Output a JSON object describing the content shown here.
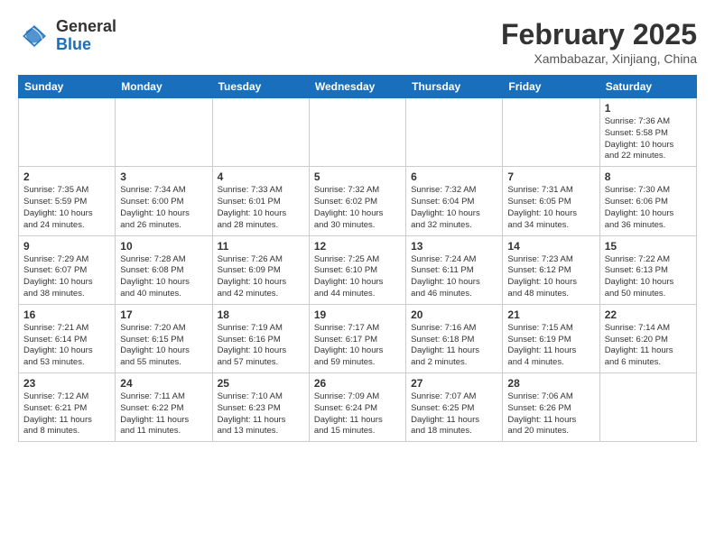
{
  "header": {
    "logo_general": "General",
    "logo_blue": "Blue",
    "month": "February 2025",
    "location": "Xambabazar, Xinjiang, China"
  },
  "days_of_week": [
    "Sunday",
    "Monday",
    "Tuesday",
    "Wednesday",
    "Thursday",
    "Friday",
    "Saturday"
  ],
  "weeks": [
    [
      {
        "day": "",
        "info": ""
      },
      {
        "day": "",
        "info": ""
      },
      {
        "day": "",
        "info": ""
      },
      {
        "day": "",
        "info": ""
      },
      {
        "day": "",
        "info": ""
      },
      {
        "day": "",
        "info": ""
      },
      {
        "day": "1",
        "info": "Sunrise: 7:36 AM\nSunset: 5:58 PM\nDaylight: 10 hours\nand 22 minutes."
      }
    ],
    [
      {
        "day": "2",
        "info": "Sunrise: 7:35 AM\nSunset: 5:59 PM\nDaylight: 10 hours\nand 24 minutes."
      },
      {
        "day": "3",
        "info": "Sunrise: 7:34 AM\nSunset: 6:00 PM\nDaylight: 10 hours\nand 26 minutes."
      },
      {
        "day": "4",
        "info": "Sunrise: 7:33 AM\nSunset: 6:01 PM\nDaylight: 10 hours\nand 28 minutes."
      },
      {
        "day": "5",
        "info": "Sunrise: 7:32 AM\nSunset: 6:02 PM\nDaylight: 10 hours\nand 30 minutes."
      },
      {
        "day": "6",
        "info": "Sunrise: 7:32 AM\nSunset: 6:04 PM\nDaylight: 10 hours\nand 32 minutes."
      },
      {
        "day": "7",
        "info": "Sunrise: 7:31 AM\nSunset: 6:05 PM\nDaylight: 10 hours\nand 34 minutes."
      },
      {
        "day": "8",
        "info": "Sunrise: 7:30 AM\nSunset: 6:06 PM\nDaylight: 10 hours\nand 36 minutes."
      }
    ],
    [
      {
        "day": "9",
        "info": "Sunrise: 7:29 AM\nSunset: 6:07 PM\nDaylight: 10 hours\nand 38 minutes."
      },
      {
        "day": "10",
        "info": "Sunrise: 7:28 AM\nSunset: 6:08 PM\nDaylight: 10 hours\nand 40 minutes."
      },
      {
        "day": "11",
        "info": "Sunrise: 7:26 AM\nSunset: 6:09 PM\nDaylight: 10 hours\nand 42 minutes."
      },
      {
        "day": "12",
        "info": "Sunrise: 7:25 AM\nSunset: 6:10 PM\nDaylight: 10 hours\nand 44 minutes."
      },
      {
        "day": "13",
        "info": "Sunrise: 7:24 AM\nSunset: 6:11 PM\nDaylight: 10 hours\nand 46 minutes."
      },
      {
        "day": "14",
        "info": "Sunrise: 7:23 AM\nSunset: 6:12 PM\nDaylight: 10 hours\nand 48 minutes."
      },
      {
        "day": "15",
        "info": "Sunrise: 7:22 AM\nSunset: 6:13 PM\nDaylight: 10 hours\nand 50 minutes."
      }
    ],
    [
      {
        "day": "16",
        "info": "Sunrise: 7:21 AM\nSunset: 6:14 PM\nDaylight: 10 hours\nand 53 minutes."
      },
      {
        "day": "17",
        "info": "Sunrise: 7:20 AM\nSunset: 6:15 PM\nDaylight: 10 hours\nand 55 minutes."
      },
      {
        "day": "18",
        "info": "Sunrise: 7:19 AM\nSunset: 6:16 PM\nDaylight: 10 hours\nand 57 minutes."
      },
      {
        "day": "19",
        "info": "Sunrise: 7:17 AM\nSunset: 6:17 PM\nDaylight: 10 hours\nand 59 minutes."
      },
      {
        "day": "20",
        "info": "Sunrise: 7:16 AM\nSunset: 6:18 PM\nDaylight: 11 hours\nand 2 minutes."
      },
      {
        "day": "21",
        "info": "Sunrise: 7:15 AM\nSunset: 6:19 PM\nDaylight: 11 hours\nand 4 minutes."
      },
      {
        "day": "22",
        "info": "Sunrise: 7:14 AM\nSunset: 6:20 PM\nDaylight: 11 hours\nand 6 minutes."
      }
    ],
    [
      {
        "day": "23",
        "info": "Sunrise: 7:12 AM\nSunset: 6:21 PM\nDaylight: 11 hours\nand 8 minutes."
      },
      {
        "day": "24",
        "info": "Sunrise: 7:11 AM\nSunset: 6:22 PM\nDaylight: 11 hours\nand 11 minutes."
      },
      {
        "day": "25",
        "info": "Sunrise: 7:10 AM\nSunset: 6:23 PM\nDaylight: 11 hours\nand 13 minutes."
      },
      {
        "day": "26",
        "info": "Sunrise: 7:09 AM\nSunset: 6:24 PM\nDaylight: 11 hours\nand 15 minutes."
      },
      {
        "day": "27",
        "info": "Sunrise: 7:07 AM\nSunset: 6:25 PM\nDaylight: 11 hours\nand 18 minutes."
      },
      {
        "day": "28",
        "info": "Sunrise: 7:06 AM\nSunset: 6:26 PM\nDaylight: 11 hours\nand 20 minutes."
      },
      {
        "day": "",
        "info": ""
      }
    ]
  ]
}
